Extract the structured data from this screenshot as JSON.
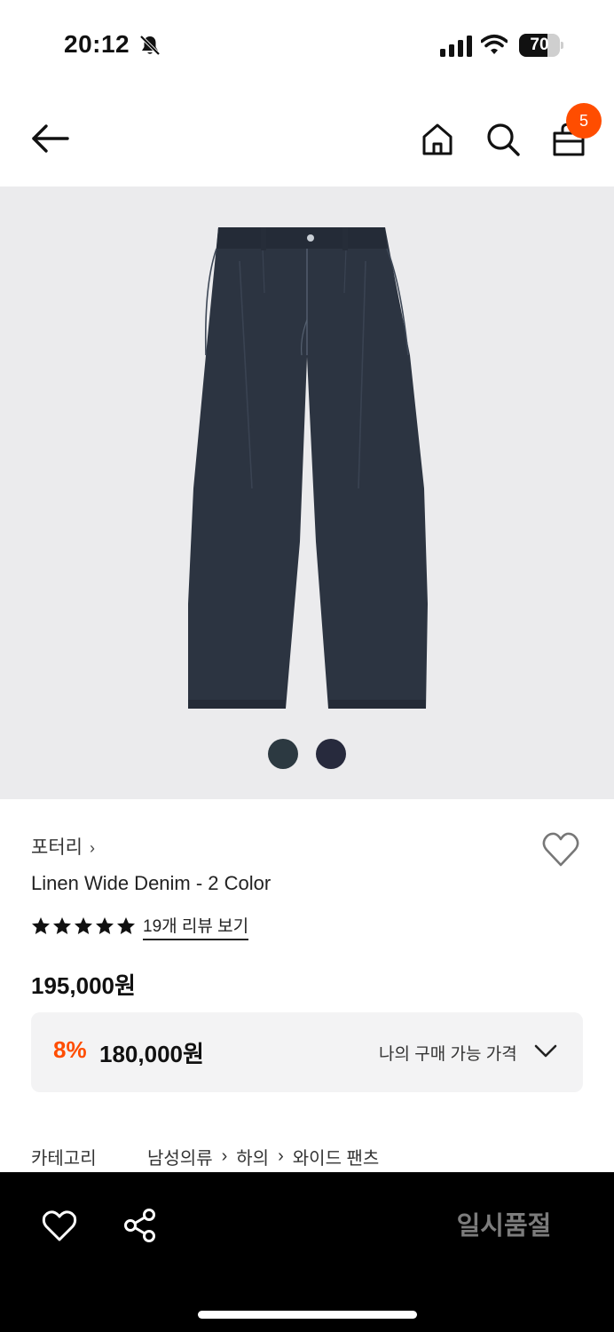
{
  "status_bar": {
    "time": "20:12",
    "battery_level": "70",
    "battery_fraction": 0.7
  },
  "header": {
    "cart_count": "5",
    "back_icon": "arrow-left-icon",
    "home_icon": "home-icon",
    "search_icon": "search-icon",
    "cart_icon": "shopping-bag-icon"
  },
  "product": {
    "swatches": [
      {
        "color": "#2c3941"
      },
      {
        "color": "#272a3d"
      }
    ],
    "brand": "포터리",
    "brand_chevron": "›",
    "name": "Linen Wide Denim - 2 Color",
    "rating_stars": 5,
    "review_link": "19개 리뷰 보기",
    "original_price": "195,000원",
    "discount_rate": "8%",
    "sale_price": "180,000원",
    "my_price_label": "나의 구매 가능 가격",
    "category_label": "카테고리",
    "category_path": [
      "남성의류",
      "하의",
      "와이드 팬츠"
    ],
    "category_sep": "›"
  },
  "bottom_bar": {
    "soldout_label": "일시품절"
  },
  "colors": {
    "accent": "#ff4d00",
    "image_bg": "#ebebed",
    "price_box_bg": "#f3f3f4",
    "bottom_bar_bg": "#000000",
    "soldout_text": "#7c7c7c"
  }
}
